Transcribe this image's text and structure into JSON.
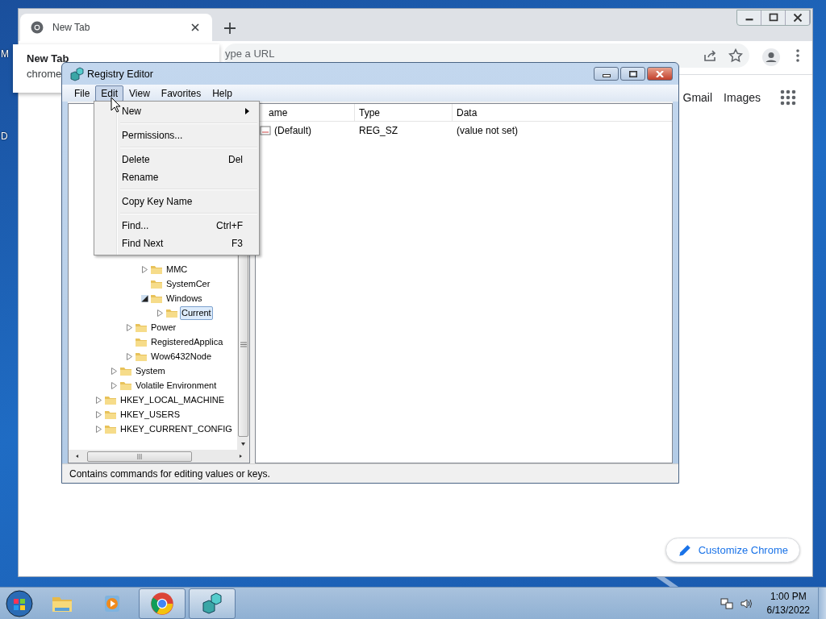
{
  "desktop_icons": [
    {
      "label": "M"
    },
    {
      "label": "D"
    }
  ],
  "browser": {
    "tabs": [
      {
        "title": "New Tab",
        "selected": true
      }
    ],
    "omnibox": {
      "placeholder": "ype a URL"
    },
    "suggestion": {
      "title": "New Tab",
      "subtitle": "chrome"
    },
    "links": [
      "Gmail",
      "Images"
    ],
    "customize_button": "Customize Chrome"
  },
  "registry_editor": {
    "title": "Registry Editor",
    "menu": [
      {
        "label": "File",
        "selected": false
      },
      {
        "label": "Edit",
        "selected": true
      },
      {
        "label": "View",
        "selected": false
      },
      {
        "label": "Favorites",
        "selected": false
      },
      {
        "label": "Help",
        "selected": false
      }
    ],
    "edit_menu": [
      {
        "kind": "submenu",
        "label": "New"
      },
      {
        "kind": "separator"
      },
      {
        "kind": "item",
        "label": "Permissions..."
      },
      {
        "kind": "separator"
      },
      {
        "kind": "item",
        "label": "Delete",
        "shortcut": "Del"
      },
      {
        "kind": "item",
        "label": "Rename"
      },
      {
        "kind": "separator"
      },
      {
        "kind": "item",
        "label": "Copy Key Name"
      },
      {
        "kind": "separator"
      },
      {
        "kind": "item",
        "label": "Find...",
        "shortcut": "Ctrl+F"
      },
      {
        "kind": "item",
        "label": "Find Next",
        "shortcut": "F3"
      }
    ],
    "tree": [
      {
        "children": [
          {
            "children": [
              {
                "children": [
                  {
                    "label": "MMC",
                    "kind": "branch",
                    "expanded": false,
                    "selected": false
                  },
                  {
                    "label": "SystemCer",
                    "kind": "leaf",
                    "selected": false
                  },
                  {
                    "label": "Windows",
                    "kind": "branch",
                    "expanded": true,
                    "selected": false,
                    "children": [
                      {
                        "label": "Current",
                        "kind": "branch",
                        "expanded": false,
                        "selected": true
                      }
                    ]
                  }
                ]
              },
              {
                "label": "Power",
                "kind": "branch",
                "expanded": false,
                "selected": false
              },
              {
                "label": "RegisteredApplica",
                "kind": "leaf",
                "selected": false
              },
              {
                "label": "Wow6432Node",
                "kind": "branch",
                "expanded": false,
                "selected": false
              }
            ]
          },
          {
            "label": "System",
            "kind": "branch",
            "expanded": false,
            "selected": false
          },
          {
            "label": "Volatile Environment",
            "kind": "branch",
            "expanded": false,
            "selected": false
          }
        ]
      },
      {
        "label": "HKEY_LOCAL_MACHINE",
        "kind": "branch",
        "expanded": false,
        "selected": false
      },
      {
        "label": "HKEY_USERS",
        "kind": "branch",
        "expanded": false,
        "selected": false
      },
      {
        "label": "HKEY_CURRENT_CONFIG",
        "kind": "branch",
        "expanded": false,
        "selected": false
      }
    ],
    "columns": [
      "ame",
      "Type",
      "Data"
    ],
    "rows": [
      {
        "name": "(Default)",
        "type": "REG_SZ",
        "data": "(value not set)"
      }
    ],
    "status_bar": "Contains commands for editing values or keys."
  },
  "taskbar": {
    "apps": [
      {
        "kind": "explorer",
        "running": false
      },
      {
        "kind": "media",
        "running": false
      },
      {
        "kind": "chrome",
        "running": true
      },
      {
        "kind": "regedit",
        "running": true
      }
    ],
    "time": "1:00 PM",
    "date": "6/13/2022"
  }
}
